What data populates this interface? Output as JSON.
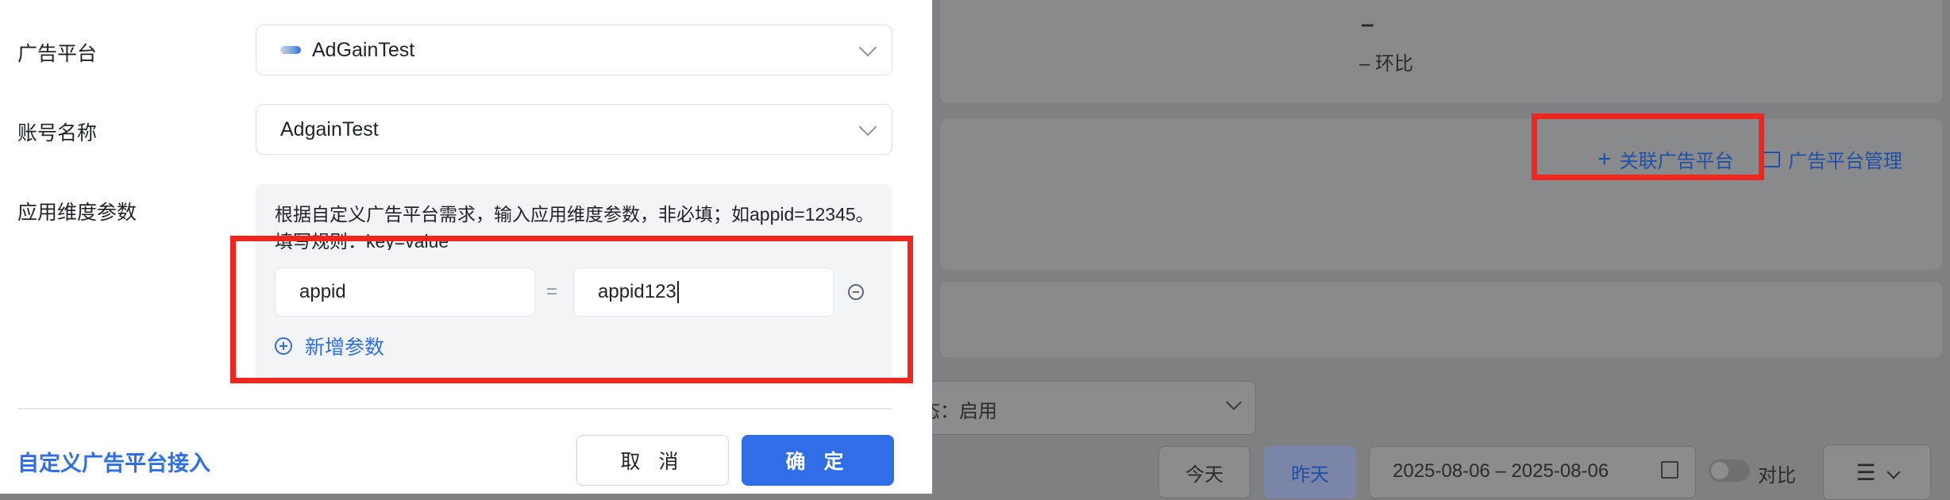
{
  "background": {
    "dash_value": "–",
    "compare_text": "– 环比",
    "link_platform": "关联广告平台",
    "manage_platform": "广告平台管理",
    "status_select": "态：启用",
    "date_today": "今天",
    "date_yesterday": "昨天",
    "date_range": "2025-08-06 – 2025-08-06",
    "compare_toggle": "对比"
  },
  "drawer": {
    "platform_label": "广告平台",
    "platform_value": "AdGainTest",
    "account_label": "账号名称",
    "account_value": "AdgainTest",
    "params_label": "应用维度参数",
    "params_hint": "根据自定义广告平台需求，输入应用维度参数，非必填；如appid=12345。填写规则：key=value",
    "param_key": "appid",
    "param_equals": "=",
    "param_value": "appid123",
    "add_param": "新增参数",
    "custom_platform_link": "自定义广告平台接入",
    "cancel_button": "取 消",
    "ok_button": "确 定"
  },
  "colors": {
    "accent": "#2f6ee6",
    "highlight_border": "#f0251d",
    "overlay": "#7f8082"
  }
}
